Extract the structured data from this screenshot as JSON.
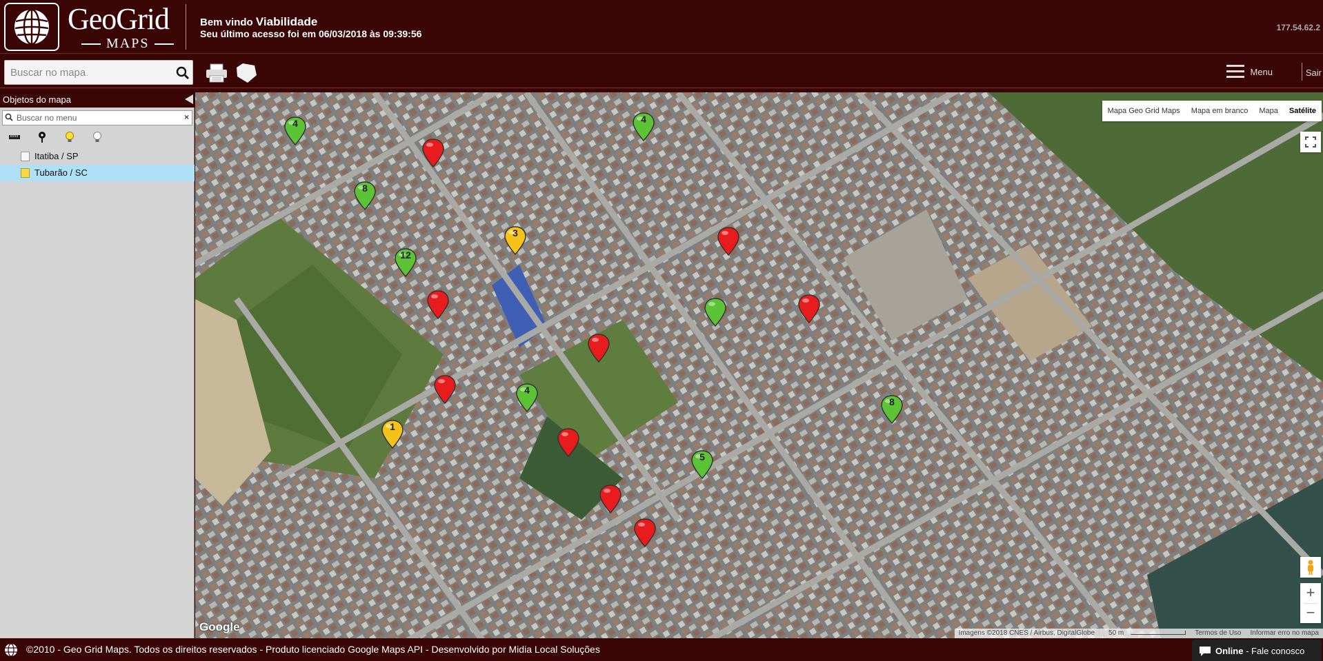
{
  "header": {
    "logo_title": "GeoGrid",
    "logo_subtitle": "MAPS",
    "welcome_prefix": "Bem vindo",
    "user_name": "Viabilidade",
    "last_access": "Seu último acesso foi em 06/03/2018 às 09:39:56",
    "ip": "177.54.62.2"
  },
  "toolbar": {
    "search_placeholder": "Buscar no mapa",
    "menu_label": "Menu",
    "logout_label": "Sair"
  },
  "sidebar": {
    "title": "Objetos do mapa",
    "search_placeholder": "Buscar no menu",
    "clear_label": "×",
    "filters": [
      "ruler-icon",
      "pin-icon",
      "bulb-on-icon",
      "bulb-off-icon"
    ],
    "items": [
      {
        "label": "Itatiba / SP",
        "selected": false
      },
      {
        "label": "Tubarão / SC",
        "selected": true
      }
    ]
  },
  "map": {
    "map_types": [
      "Mapa Geo Grid Maps",
      "Mapa em branco",
      "Mapa",
      "Satélite"
    ],
    "active_map_type": "Satélite",
    "google_logo": "Google",
    "attribution": "Imagens ©2018 CNES / Airbus, DigitalGlobe",
    "scale": "50 m",
    "terms": "Termos de Uso",
    "report": "Informar erro no mapa",
    "zoom_in": "+",
    "zoom_out": "−",
    "markers": [
      {
        "color": "green",
        "label": "4"
      },
      {
        "color": "green",
        "label": "4"
      },
      {
        "color": "red",
        "label": ""
      },
      {
        "color": "green",
        "label": "8"
      },
      {
        "color": "red",
        "label": ""
      },
      {
        "color": "yellow",
        "label": "3"
      },
      {
        "color": "green",
        "label": "12"
      },
      {
        "color": "red",
        "label": ""
      },
      {
        "color": "green",
        "label": ""
      },
      {
        "color": "red",
        "label": ""
      },
      {
        "color": "red",
        "label": ""
      },
      {
        "color": "red",
        "label": ""
      },
      {
        "color": "green",
        "label": "4"
      },
      {
        "color": "green",
        "label": "8"
      },
      {
        "color": "yellow",
        "label": "1"
      },
      {
        "color": "red",
        "label": ""
      },
      {
        "color": "green",
        "label": "5"
      },
      {
        "color": "red",
        "label": ""
      },
      {
        "color": "red",
        "label": ""
      }
    ],
    "colors": {
      "red": "#e81c1c",
      "green": "#5cc236",
      "yellow": "#f5c21a"
    }
  },
  "footer": {
    "text": "©2010 - Geo Grid Maps. Todos os direitos reservados - Produto licenciado Google Maps API - Desenvolvido por Midia Local Soluções",
    "chat_status": "Online",
    "chat_label": " - Fale conosco"
  }
}
